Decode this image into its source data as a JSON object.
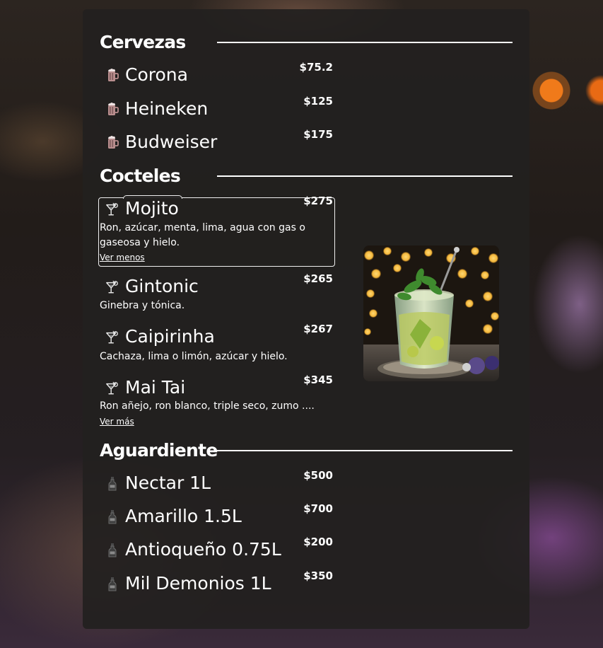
{
  "sections": [
    {
      "title": "Cervezas",
      "items": [
        {
          "name": "Corona",
          "price": "$75.2",
          "icon": "beer-mug-icon"
        },
        {
          "name": "Heineken",
          "price": "$125",
          "icon": "beer-mug-icon"
        },
        {
          "name": "Budweiser",
          "price": "$175",
          "icon": "beer-mug-icon"
        }
      ]
    },
    {
      "title": "Cocteles",
      "items": [
        {
          "name": "Mojito",
          "price": "$275",
          "icon": "cocktail-glass-icon",
          "description": "Ron, azúcar, menta, lima, agua con gas o gaseosa y hielo.",
          "toggle": "Ver menos",
          "selected": true
        },
        {
          "name": "Gintonic",
          "price": "$265",
          "icon": "cocktail-glass-icon",
          "description": "Ginebra y tónica."
        },
        {
          "name": "Caipirinha",
          "price": "$267",
          "icon": "cocktail-glass-icon",
          "description": "Cachaza, lima o limón, azúcar y hielo."
        },
        {
          "name": "Mai Tai",
          "price": "$345",
          "icon": "cocktail-glass-icon",
          "description": "Ron añejo, ron blanco, triple seco, zumo ....",
          "toggle": "Ver más"
        }
      ],
      "image": {
        "subject": "mojito-cocktail-photo"
      }
    },
    {
      "title": "Aguardiente",
      "items": [
        {
          "name": "Nectar 1L",
          "price": "$500",
          "icon": "liquor-bottle-icon"
        },
        {
          "name": "Amarillo 1.5L",
          "price": "$700",
          "icon": "liquor-bottle-icon"
        },
        {
          "name": "Antioqueño 0.75L",
          "price": "$200",
          "icon": "liquor-bottle-icon"
        },
        {
          "name": "Mil Demonios 1L",
          "price": "$350",
          "icon": "liquor-bottle-icon"
        }
      ]
    }
  ],
  "colors": {
    "panel": "#22201f",
    "text": "#ffffff",
    "beer_icon": "#c8a8a8",
    "outline": "#f0f0f0"
  }
}
